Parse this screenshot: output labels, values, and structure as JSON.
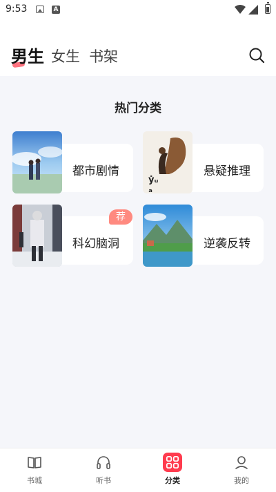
{
  "status_bar": {
    "time": "9:53",
    "notification_a": "A"
  },
  "header": {
    "tabs": [
      {
        "label": "男生",
        "active": true
      },
      {
        "label": "女生",
        "active": false
      },
      {
        "label": "书架",
        "active": false
      }
    ]
  },
  "main": {
    "section_title": "热门分类",
    "categories": [
      {
        "label": "都市剧情",
        "badge": ""
      },
      {
        "label": "悬疑推理",
        "badge": ""
      },
      {
        "label": "科幻脑洞",
        "badge": "荐"
      },
      {
        "label": "逆袭反转",
        "badge": ""
      }
    ]
  },
  "bottom_nav": {
    "items": [
      {
        "label": "书城",
        "icon": "book-icon",
        "active": false
      },
      {
        "label": "听书",
        "icon": "headphones-icon",
        "active": false
      },
      {
        "label": "分类",
        "icon": "grid-icon",
        "active": true
      },
      {
        "label": "我的",
        "icon": "user-icon",
        "active": false
      }
    ]
  },
  "colors": {
    "accent": "#ff3b4e",
    "badge": "#ff8a80",
    "background": "#f5f6fa"
  }
}
